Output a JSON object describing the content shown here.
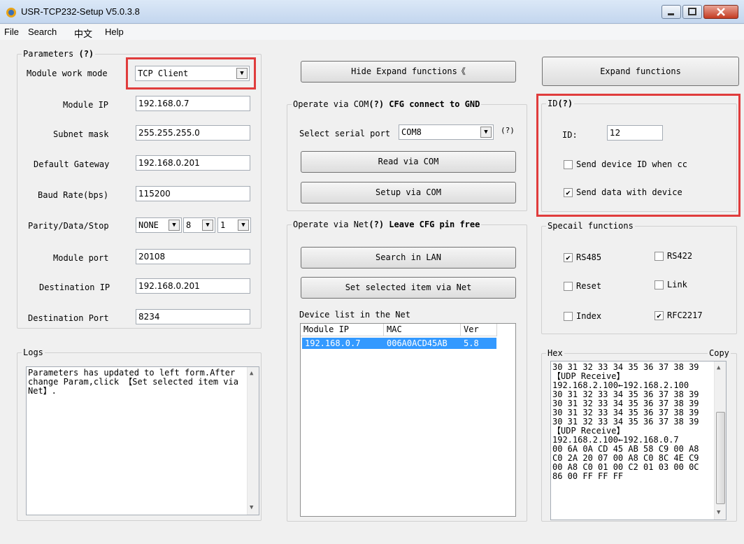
{
  "window": {
    "title": "USR-TCP232-Setup V5.0.3.8"
  },
  "menu": [
    "File",
    "Search",
    "中文",
    "Help"
  ],
  "params": {
    "legend": "Parameters",
    "help": "(?)",
    "work_mode_label": "Module work mode",
    "work_mode_value": "TCP Client",
    "module_ip_label": "Module IP",
    "module_ip": "192.168.0.7",
    "subnet_label": "Subnet mask",
    "subnet": "255.255.255.0",
    "gateway_label": "Default Gateway",
    "gateway": "192.168.0.201",
    "baud_label": "Baud Rate(bps)",
    "baud": "115200",
    "pds_label": "Parity/Data/Stop",
    "parity": "NONE",
    "data_bits": "8",
    "stop_bits": "1",
    "port_label": "Module port",
    "port": "20108",
    "dest_ip_label": "Destination IP",
    "dest_ip": "192.168.0.201",
    "dest_port_label": "Destination Port",
    "dest_port": "8234"
  },
  "buttons": {
    "hide_expand": "Hide Expand functions《",
    "expand": "Expand functions",
    "read_com": "Read via COM",
    "setup_com": "Setup via COM",
    "search_lan": "Search in LAN",
    "set_net": "Set selected item via Net"
  },
  "com": {
    "legend": "Operate via COM",
    "help": "(?)",
    "note": "CFG connect to GND",
    "select_label": "Select serial port",
    "port_value": "COM8",
    "port_help": "(?)"
  },
  "net": {
    "legend": "Operate via Net",
    "help": "(?)",
    "note": "Leave CFG pin free",
    "device_list_label": "Device list in the Net",
    "columns": [
      "Module IP",
      "MAC",
      "Ver"
    ],
    "rows": [
      {
        "ip": "192.168.0.7",
        "mac": "006A0ACD45AB",
        "ver": "5.8"
      }
    ]
  },
  "id_group": {
    "legend": "ID",
    "help": "(?)",
    "id_label": "ID:",
    "id_value": "12",
    "send_id_label": "Send device ID when cc",
    "send_id_checked": false,
    "send_data_label": "Send data with device",
    "send_data_checked": true
  },
  "special": {
    "legend": "Specail functions",
    "rs485": "RS485",
    "rs485_checked": true,
    "rs422": "RS422",
    "rs422_checked": false,
    "reset": "Reset",
    "reset_checked": false,
    "link": "Link",
    "link_checked": false,
    "index": "Index",
    "index_checked": false,
    "rfc2217": "RFC2217",
    "rfc2217_checked": true
  },
  "logs": {
    "legend": "Logs",
    "lines": [
      "Parameters has updated to left form.After",
      "change Param,click 【Set selected item via",
      "Net】."
    ]
  },
  "hex": {
    "legend": "Hex",
    "copy": "Copy",
    "lines": [
      "30 31 32 33 34 35 36 37 38 39",
      "【UDP Receive】",
      "192.168.2.100←192.168.2.100",
      "30 31 32 33 34 35 36 37 38 39",
      "30 31 32 33 34 35 36 37 38 39",
      "30 31 32 33 34 35 36 37 38 39",
      "30 31 32 33 34 35 36 37 38 39",
      "【UDP Receive】",
      "192.168.2.100←192.168.0.7",
      "00 6A 0A CD 45 AB 58 C9 00 A8",
      "C0 2A 20 07 00 A8 C0 8C 4E C9",
      "00 A8 C0 01 00 C2 01 03 00 0C",
      "86 00 FF FF FF"
    ]
  },
  "colors": {
    "highlight": "#e03c3c",
    "selection": "#3399ff"
  }
}
